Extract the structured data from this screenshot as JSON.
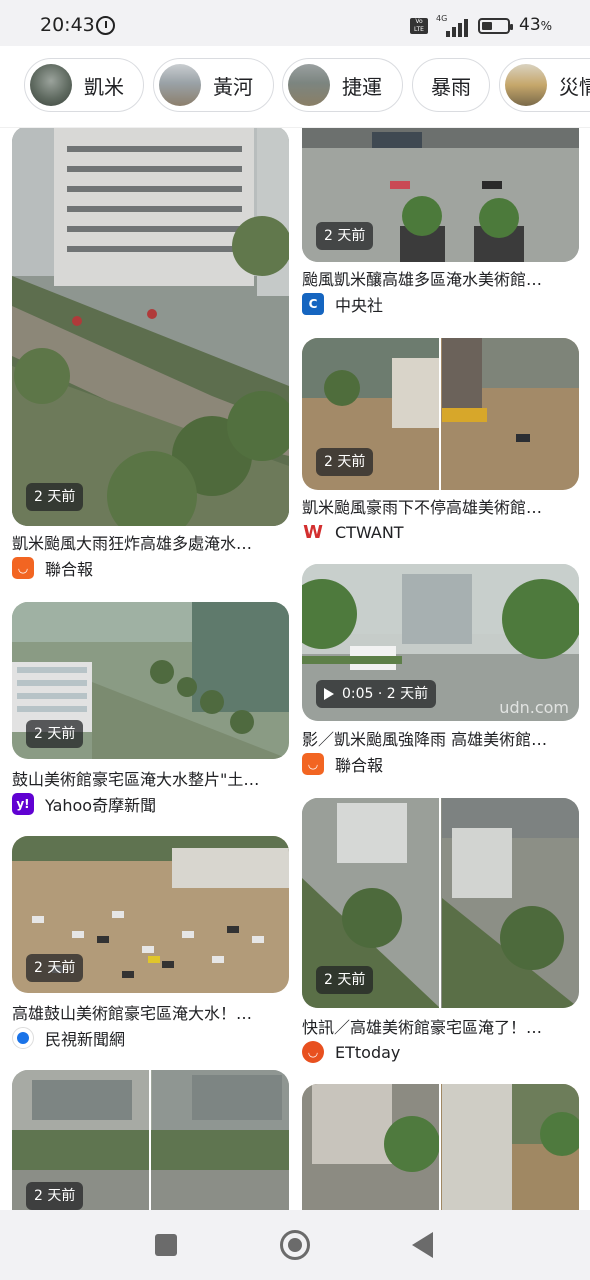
{
  "status_bar": {
    "time": "20:43",
    "volte": "Vo LTE",
    "network": "4G",
    "battery_percent": "43",
    "battery_unit": "%",
    "battery_level": 0.43,
    "icons": [
      "alarm-icon",
      "volte-icon",
      "signal-icon",
      "battery-icon"
    ]
  },
  "chips": [
    {
      "label": "凱米"
    },
    {
      "label": "黃河"
    },
    {
      "label": "捷運"
    },
    {
      "label": "暴雨"
    },
    {
      "label": "災情"
    }
  ],
  "results": [
    {
      "time_badge": "2 天前",
      "caption": "凱米颱風大雨狂炸高雄多處淹水…",
      "source": "聯合報",
      "source_icon": "udn-icon"
    },
    {
      "time_badge": "2 天前",
      "caption": "鼓山美術館豪宅區淹大水整片\"土…",
      "source": "Yahoo奇摩新聞",
      "source_icon": "yahoo-icon"
    },
    {
      "time_badge": "2 天前",
      "caption": "高雄鼓山美術館豪宅區淹大水！…",
      "source": "民視新聞網",
      "source_icon": "ftv-icon"
    },
    {
      "time_badge": "2 天前"
    },
    {
      "time_badge": "2 天前",
      "caption": "颱風凱米釀高雄多區淹水美術館…",
      "source": "中央社",
      "source_icon": "cna-icon"
    },
    {
      "time_badge": "2 天前",
      "caption": "凱米颱風豪雨下不停高雄美術館…",
      "source": "CTWANT",
      "source_icon": "ctwant-icon"
    },
    {
      "time_badge": "0:05 · 2 天前",
      "caption": "影／凱米颱風強降雨 高雄美術館…",
      "source": "聯合報",
      "source_icon": "udn-icon",
      "has_video": true,
      "watermark": "udn.com"
    },
    {
      "time_badge": "2 天前",
      "caption": "快訊／高雄美術館豪宅區淹了！…",
      "source": "ETtoday",
      "source_icon": "ettoday-icon"
    },
    {}
  ],
  "colors": {
    "udn": "#f26522",
    "yahoo": "#6001d2",
    "ftv": "#1a73e8",
    "cna": "#1565c0",
    "ctwant": "#d32f2f",
    "ettoday": "#e8501f"
  },
  "nav_bar": {
    "icons": [
      "recents-icon",
      "home-icon",
      "back-icon"
    ]
  }
}
